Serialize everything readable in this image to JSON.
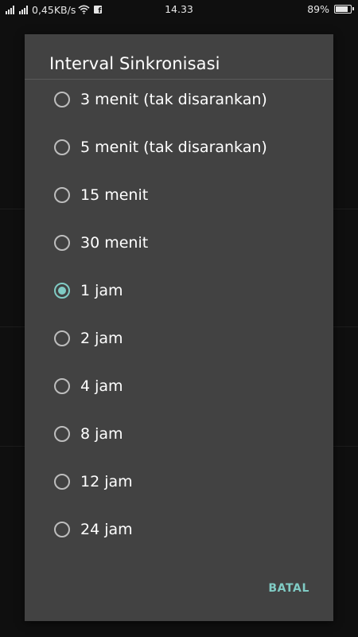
{
  "status_bar": {
    "net_speed": "0,45KB/s",
    "time": "14.33",
    "battery": "89%",
    "battery_level": 0.89,
    "icons": [
      "signal-icon",
      "signal-icon",
      "wifi-icon",
      "facebook-icon",
      "battery-icon"
    ]
  },
  "dialog": {
    "title": "Interval Sinkronisasi",
    "options": [
      {
        "label": "3 menit (tak disarankan)",
        "checked": false
      },
      {
        "label": "5 menit (tak disarankan)",
        "checked": false
      },
      {
        "label": "15 menit",
        "checked": false
      },
      {
        "label": "30 menit",
        "checked": false
      },
      {
        "label": "1 jam",
        "checked": true
      },
      {
        "label": "2 jam",
        "checked": false
      },
      {
        "label": "4 jam",
        "checked": false
      },
      {
        "label": "8 jam",
        "checked": false
      },
      {
        "label": "12 jam",
        "checked": false
      },
      {
        "label": "24 jam",
        "checked": false
      }
    ],
    "cancel_label": "BATAL"
  },
  "colors": {
    "accent": "#80cbc4",
    "dialog_bg": "#424242",
    "screen_bg": "#0f0f0f"
  }
}
